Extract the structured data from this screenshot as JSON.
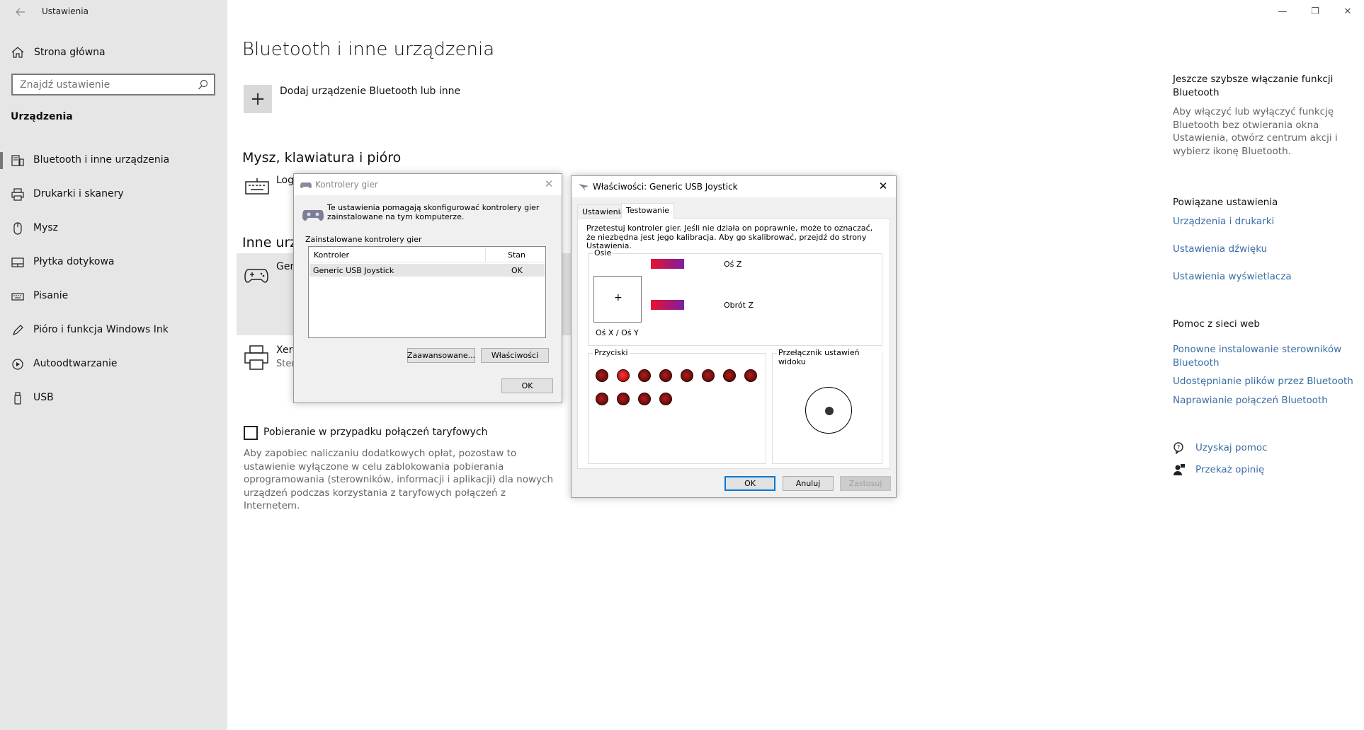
{
  "window": {
    "title": "Ustawienia",
    "controls": [
      "—",
      "❐",
      "✕"
    ]
  },
  "sidebar": {
    "home": "Strona główna",
    "search_placeholder": "Znajdź ustawienie",
    "section": "Urządzenia",
    "items": [
      {
        "label": "Bluetooth i inne urządzenia",
        "icon": "bluetooth-devices-icon"
      },
      {
        "label": "Drukarki i skanery",
        "icon": "printer-icon"
      },
      {
        "label": "Mysz",
        "icon": "mouse-icon"
      },
      {
        "label": "Płytka dotykowa",
        "icon": "touchpad-icon"
      },
      {
        "label": "Pisanie",
        "icon": "keyboard-icon"
      },
      {
        "label": "Pióro i funkcja Windows Ink",
        "icon": "pen-icon"
      },
      {
        "label": "Autoodtwarzanie",
        "icon": "autoplay-icon"
      },
      {
        "label": "USB",
        "icon": "usb-icon"
      }
    ]
  },
  "main": {
    "title": "Bluetooth i inne urządzenia",
    "add_device": "Dodaj urządzenie Bluetooth lub inne",
    "section_mouse": "Mysz, klawiatura i pióro",
    "section_other": "Inne urz",
    "devices": {
      "keyboard_name": "Log",
      "gamepad_name": "Gen",
      "printer_name": "Xero",
      "printer_sub": "Ster"
    },
    "metered": {
      "label": "Pobieranie w przypadku połączeń taryfowych",
      "description": "Aby zapobiec naliczaniu dodatkowych opłat, pozostaw to ustawienie wyłączone w celu zablokowania pobierania oprogramowania (sterowników, informacji i aplikacji) dla nowych urządzeń podczas korzystania z taryfowych połączeń z Internetem."
    }
  },
  "right": {
    "bt_head": "Jeszcze szybsze włączanie funkcji Bluetooth",
    "bt_text": "Aby włączyć lub wyłączyć funkcję Bluetooth bez otwierania okna Ustawienia, otwórz centrum akcji i wybierz ikonę Bluetooth.",
    "related_head": "Powiązane ustawienia",
    "related_links": [
      "Urządzenia i drukarki",
      "Ustawienia dźwięku",
      "Ustawienia wyświetlacza"
    ],
    "help_head": "Pomoc z sieci web",
    "help_links": [
      "Ponowne instalowanie sterowników Bluetooth",
      "Udostępnianie plików przez Bluetooth",
      "Naprawianie połączeń Bluetooth"
    ],
    "get_help": "Uzyskaj pomoc",
    "feedback": "Przekaż opinię"
  },
  "game_controllers": {
    "title": "Kontrolery gier",
    "info": "Te ustawienia pomagają skonfigurować kontrolery gier zainstalowane na tym komputerze.",
    "group": "Zainstalowane kontrolery gier",
    "col_controller": "Kontroler",
    "col_status": "Stan",
    "rows": [
      {
        "name": "Generic   USB  Joystick",
        "status": "OK"
      }
    ],
    "advanced": "Zaawansowane...",
    "properties": "Właściwości",
    "ok": "OK"
  },
  "properties": {
    "title": "Właściwości: Generic   USB  Joystick",
    "tabs": [
      "Ustawienia",
      "Testowanie"
    ],
    "active_tab": "Testowanie",
    "description": "Przetestuj kontroler gier. Jeśli nie działa on poprawnie, może to oznaczać, że niezbędna jest jego kalibracja. Aby go skalibrować, przejdź do strony Ustawienia.",
    "axes_group": "Osie",
    "axis_z": "Oś Z",
    "rot_z": "Obrót Z",
    "xy_label": "Oś X / Oś Y",
    "buttons_group": "Przyciski",
    "button_count": 12,
    "pressed_button": 2,
    "pov_group": "Przełącznik ustawień widoku",
    "ok": "OK",
    "cancel": "Anuluj",
    "apply": "Zastosuj"
  },
  "colors": {
    "sidebar_bg": "#e6e6e6",
    "link": "#3b6ea5",
    "accent": "#0078d7",
    "axis_start": "#e8112d",
    "axis_end": "#7b1fa2",
    "joy_button": "#8b1212"
  }
}
